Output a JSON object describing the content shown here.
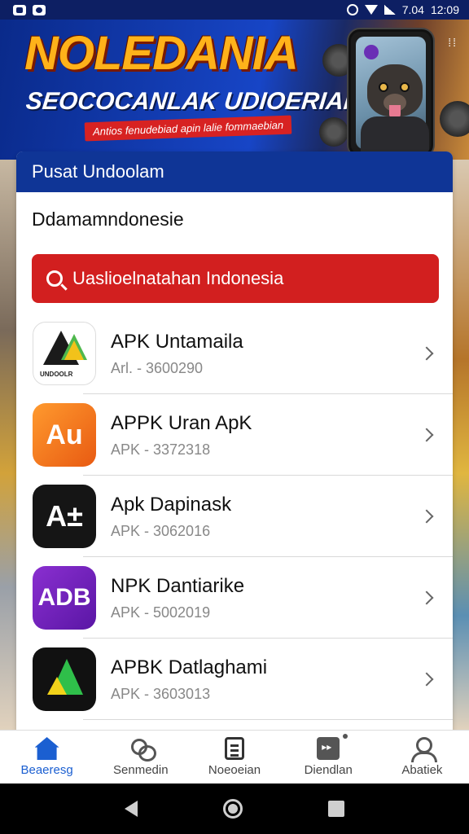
{
  "status_bar": {
    "time": "12:09",
    "indicator": "7.04"
  },
  "banner": {
    "title": "NOLEDANIA",
    "subtitle": "SEOCOCANLAK UDIOERIAN",
    "tag": "Antios fenudebiad apin lalie fommaebian"
  },
  "card": {
    "header": "Pusat Undoolam",
    "subtitle": "Ddamamndonesie",
    "search_placeholder": "Uaslioelnatahan Indonesia"
  },
  "apps": [
    {
      "name": "APK Untamaila",
      "meta": "Arl. - 3600290",
      "icon": "triangle-logo-icon",
      "icon_text": "UNDOOLR"
    },
    {
      "name": "APPK Uran ApK",
      "meta": "APK - 3372318",
      "icon": "au-logo-icon",
      "icon_text": "Au"
    },
    {
      "name": "Apk Dapinask",
      "meta": "APK - 3062016",
      "icon": "a-plus-minus-icon",
      "icon_text": "A±"
    },
    {
      "name": "NPK Dantiarike",
      "meta": "APK - 5002019",
      "icon": "adb-logo-icon",
      "icon_text": "ADB"
    },
    {
      "name": "APBK Datlaghami",
      "meta": "APK - 3603013",
      "icon": "green-a-logo-icon",
      "icon_text": ""
    }
  ],
  "bottom_nav": [
    {
      "label": "Beaeresg",
      "icon": "home-icon",
      "active": true
    },
    {
      "label": "Senmedin",
      "icon": "users-icon",
      "active": false
    },
    {
      "label": "Noeoeian",
      "icon": "document-icon",
      "active": false
    },
    {
      "label": "Diendlan",
      "icon": "download-icon",
      "active": false
    },
    {
      "label": "Abatiek",
      "icon": "profile-icon",
      "active": false
    }
  ],
  "colors": {
    "header_blue": "#0f3596",
    "search_red": "#d21f1f",
    "active_blue": "#1b5fd1"
  }
}
